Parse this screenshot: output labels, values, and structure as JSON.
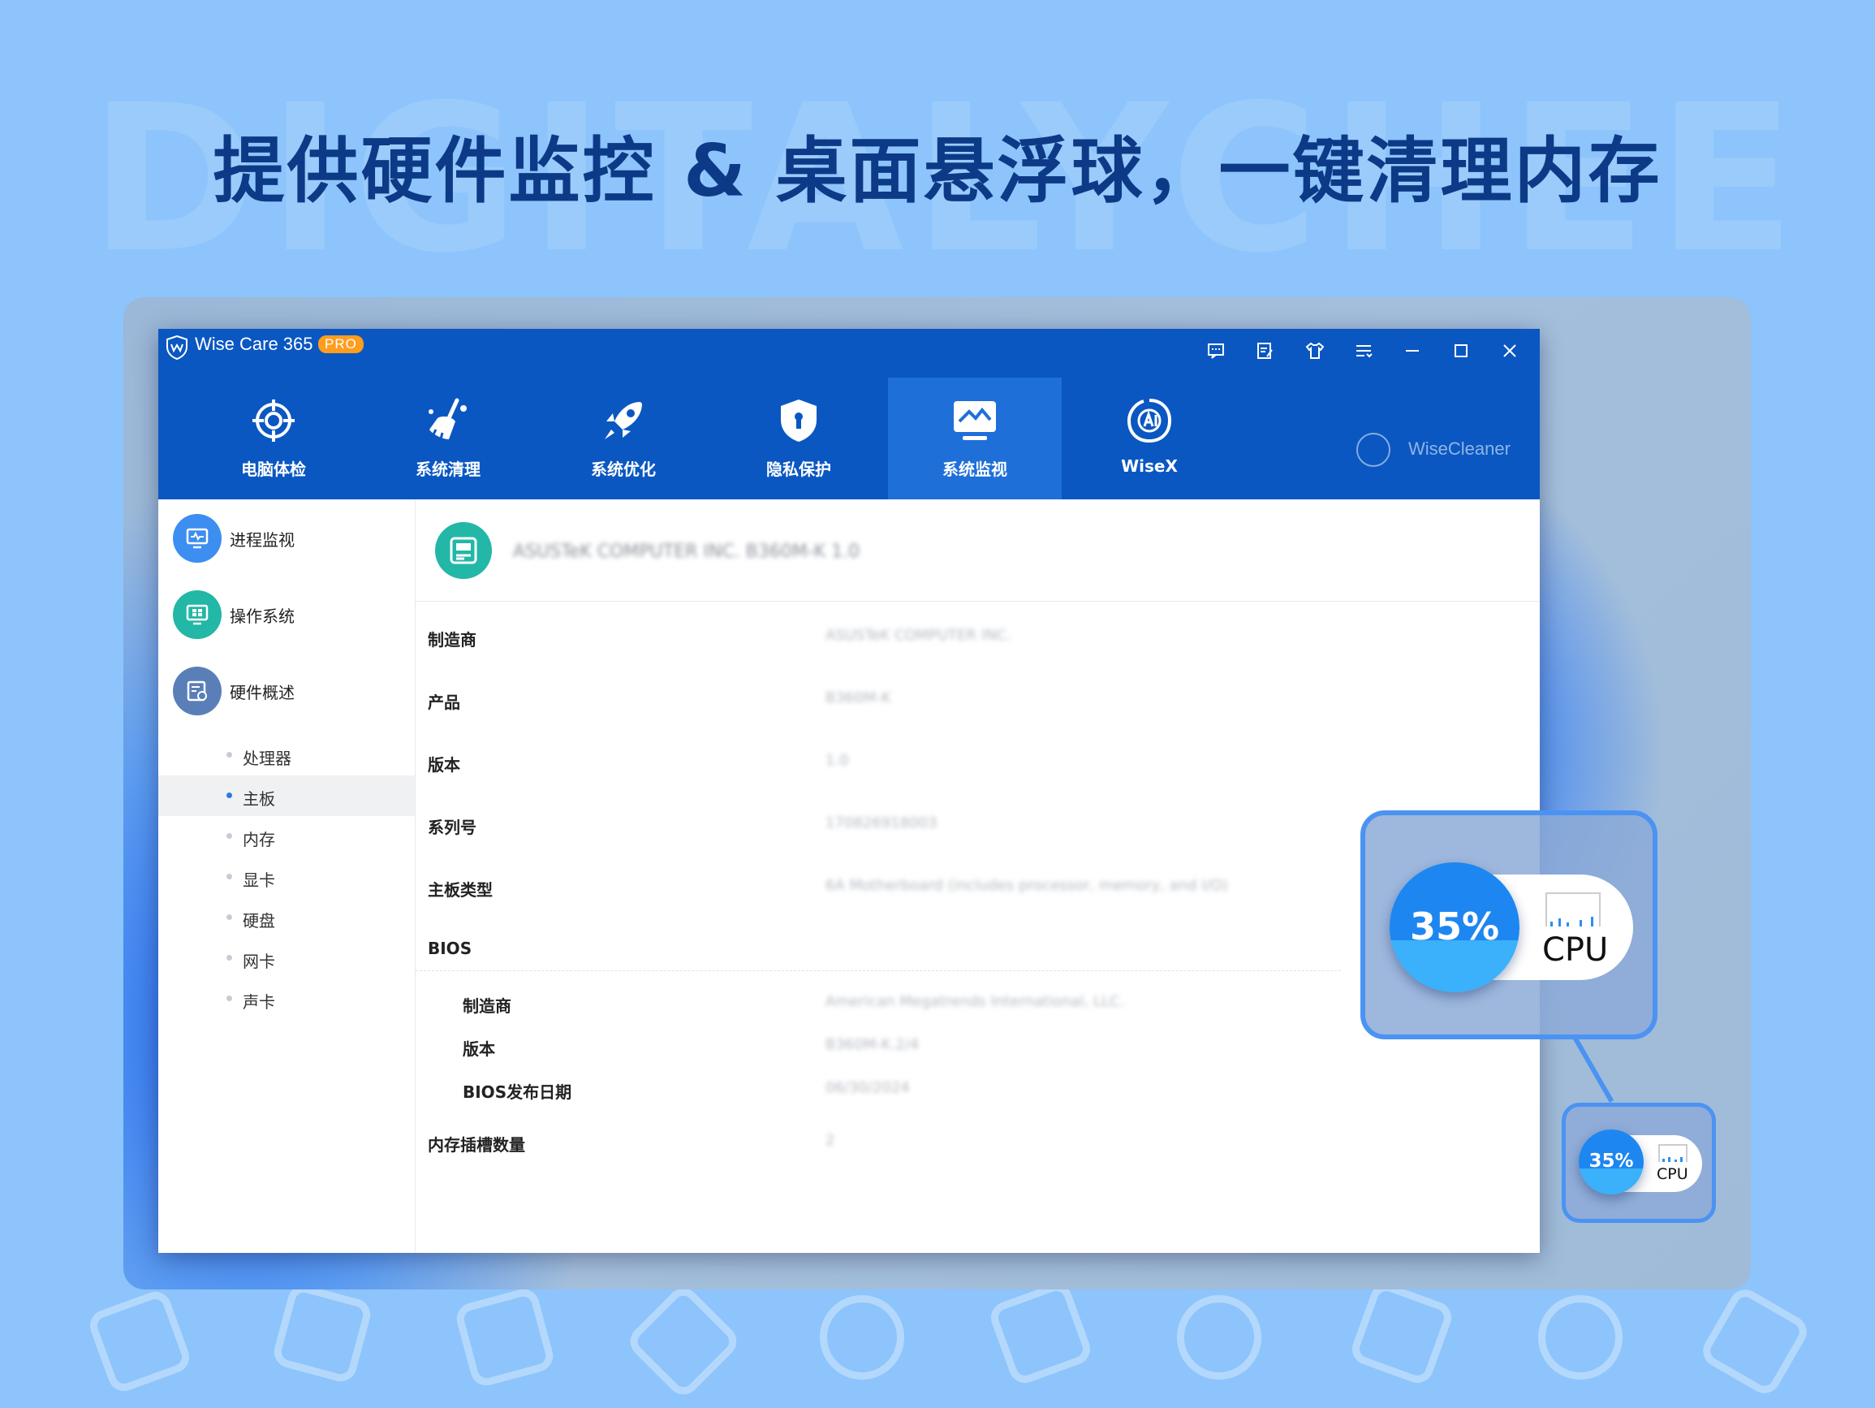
{
  "watermark": "DIGITALYCHEE",
  "headline": "提供硬件监控 & 桌面悬浮球，一键清理内存",
  "app": {
    "title": "Wise Care 365",
    "badge": "PRO",
    "brand": "WiseCleaner"
  },
  "window_controls": [
    "feedback-icon",
    "notes-icon",
    "skin-icon",
    "menu-icon",
    "minimize-icon",
    "maximize-icon",
    "close-icon"
  ],
  "nav_tabs": [
    {
      "label": "电脑体检",
      "icon": "target-icon"
    },
    {
      "label": "系统清理",
      "icon": "broom-icon"
    },
    {
      "label": "系统优化",
      "icon": "rocket-icon"
    },
    {
      "label": "隐私保护",
      "icon": "shield-icon"
    },
    {
      "label": "系统监视",
      "icon": "monitor-icon",
      "active": true
    },
    {
      "label": "WiseX",
      "icon": "wisex-icon"
    }
  ],
  "sidebar": {
    "main": [
      {
        "label": "进程监视",
        "icon": "process-monitor-icon",
        "color": "#3c8ef0"
      },
      {
        "label": "操作系统",
        "icon": "windows-os-icon",
        "color": "#22b7a6"
      },
      {
        "label": "硬件概述",
        "icon": "hardware-icon",
        "color": "#5a7fb8"
      }
    ],
    "sub": [
      {
        "label": "处理器"
      },
      {
        "label": "主板",
        "selected": true
      },
      {
        "label": "内存"
      },
      {
        "label": "显卡"
      },
      {
        "label": "硬盘"
      },
      {
        "label": "网卡"
      },
      {
        "label": "声卡"
      }
    ]
  },
  "content": {
    "header_value": "ASUSTeK COMPUTER INC. B360M-K 1.0",
    "properties": [
      {
        "label": "制造商",
        "value": "ASUSTeK COMPUTER INC."
      },
      {
        "label": "产品",
        "value": "B360M-K"
      },
      {
        "label": "版本",
        "value": "1.0"
      },
      {
        "label": "系列号",
        "value": "170826918003"
      },
      {
        "label": "主板类型",
        "value": "6A Motherboard (includes processor, memory, and I/O)"
      },
      {
        "label": "BIOS",
        "value": ""
      }
    ],
    "bios": [
      {
        "label": "制造商",
        "value": "American Megatrends International, LLC."
      },
      {
        "label": "版本",
        "value": "B360M-K.2/4"
      },
      {
        "label": "BIOS发布日期",
        "value": "06/30/2024"
      }
    ],
    "slots": {
      "label": "内存插槽数量",
      "value": "2"
    }
  },
  "floating_monitor": {
    "percent": "35%",
    "label": "CPU",
    "fill_fraction": 0.35
  },
  "colors": {
    "accent": "#0a57c2",
    "active_tab": "#1f6fd8",
    "ball": "#1e86f0",
    "frame": "#4b93f2"
  }
}
